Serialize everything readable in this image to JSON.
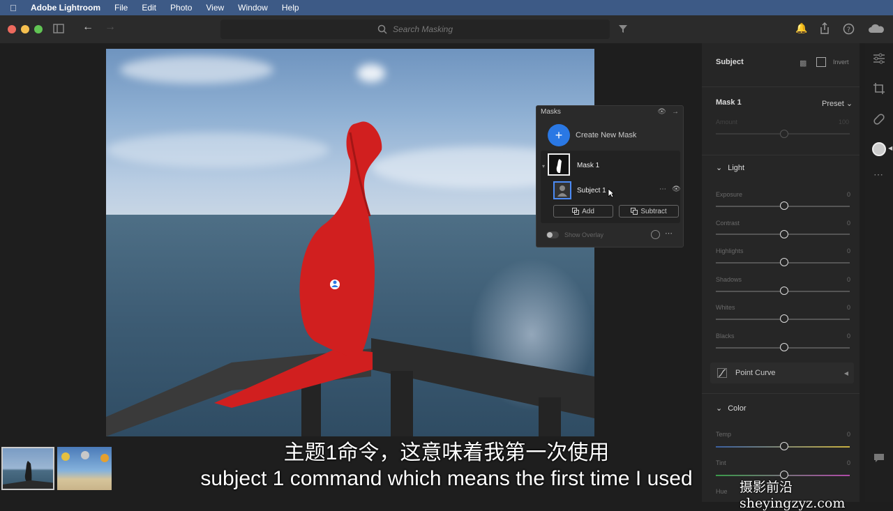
{
  "menubar": {
    "app_name": "Adobe Lightroom",
    "items": [
      "File",
      "Edit",
      "Photo",
      "View",
      "Window",
      "Help"
    ]
  },
  "toolbar": {
    "search_placeholder": "Search Masking"
  },
  "masks_panel": {
    "title": "Masks",
    "create_label": "Create New Mask",
    "mask_name": "Mask 1",
    "subject_name": "Subject 1",
    "add_label": "Add",
    "subtract_label": "Subtract",
    "overlay_label": "Show Overlay"
  },
  "right_panel": {
    "subject_title": "Subject",
    "invert_label": "Invert",
    "mask_title": "Mask 1",
    "preset_label": "Preset",
    "amount_label": "Amount",
    "amount_value": "100",
    "light_title": "Light",
    "sliders": [
      {
        "label": "Exposure",
        "value": "0"
      },
      {
        "label": "Contrast",
        "value": "0"
      },
      {
        "label": "Highlights",
        "value": "0"
      },
      {
        "label": "Shadows",
        "value": "0"
      },
      {
        "label": "Whites",
        "value": "0"
      },
      {
        "label": "Blacks",
        "value": "0"
      }
    ],
    "point_curve": "Point Curve",
    "color_title": "Color",
    "color_sliders": [
      {
        "label": "Temp",
        "value": "0"
      },
      {
        "label": "Tint",
        "value": "0"
      },
      {
        "label": "Hue",
        "value": ""
      }
    ]
  },
  "subtitles": {
    "chinese": "主题1命令，这意味着我第一次使用",
    "english": "subject 1 command which means the first time I used"
  },
  "watermark": "摄影前沿 sheyingzyz.com",
  "colors": {
    "mask_red": "#d11f1f",
    "accent_blue": "#2a78e4",
    "menubar": "#3d5a86"
  }
}
